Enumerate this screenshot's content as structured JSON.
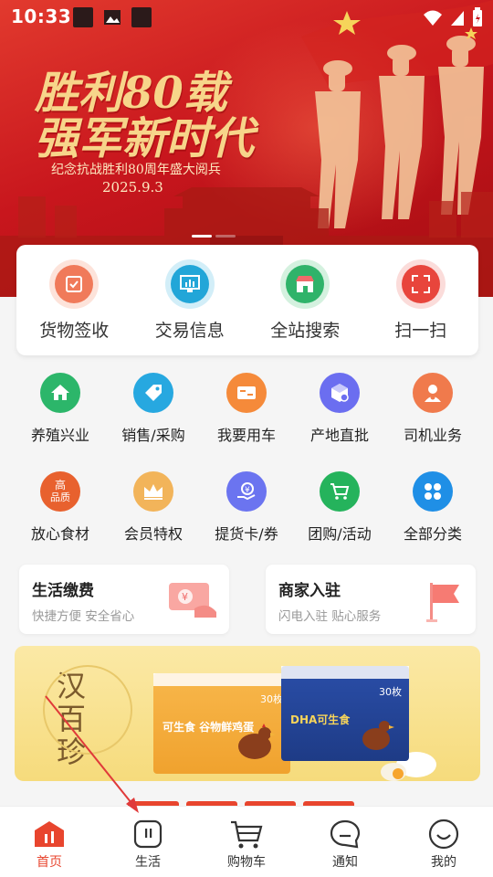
{
  "status_bar": {
    "time": "10:33"
  },
  "banner": {
    "title_line1": "胜利80载",
    "title_line2": "强军新时代",
    "subtitle": "纪念抗战胜利80周年盛大阅兵",
    "date": "2025.9.3"
  },
  "quick_actions": [
    {
      "label": "货物签收",
      "icon": "package-check-icon",
      "color": "#f07a5a"
    },
    {
      "label": "交易信息",
      "icon": "monitor-chart-icon",
      "color": "#22a6d8"
    },
    {
      "label": "全站搜索",
      "icon": "store-icon",
      "color": "#2fb36a"
    },
    {
      "label": "扫一扫",
      "icon": "scan-icon",
      "color": "#e8453c"
    }
  ],
  "grid_row1": [
    {
      "label": "养殖兴业",
      "color": "#2cb66a"
    },
    {
      "label": "销售/采购",
      "color": "#27a8e0"
    },
    {
      "label": "我要用车",
      "color": "#f58a3a"
    },
    {
      "label": "产地直批",
      "color": "#6b6ef0"
    },
    {
      "label": "司机业务",
      "color": "#f07a4c"
    }
  ],
  "grid_row2": [
    {
      "label": "放心食材",
      "badge_top": "高",
      "badge_bottom": "品质",
      "color": "#e8612e"
    },
    {
      "label": "会员特权",
      "color": "#f2b45a"
    },
    {
      "label": "提货卡/券",
      "color": "#6b74f0"
    },
    {
      "label": "团购/活动",
      "color": "#25b35c"
    },
    {
      "label": "全部分类",
      "color": "#1f8fe6"
    }
  ],
  "service_cards": [
    {
      "title": "生活缴费",
      "subtitle": "快捷方便 安全省心"
    },
    {
      "title": "商家入驻",
      "subtitle": "闪电入驻 贴心服务"
    }
  ],
  "promo": {
    "brand": "汉百珍",
    "box1_text": "可生食 谷物鲜鸡蛋",
    "box1_tag": "30枚",
    "box2_text": "DHA可生食",
    "box2_tag": "30枚"
  },
  "tabbar": [
    {
      "label": "首页",
      "icon": "home-icon",
      "active": true
    },
    {
      "label": "生活",
      "icon": "life-icon",
      "active": false
    },
    {
      "label": "购物车",
      "icon": "cart-icon",
      "active": false
    },
    {
      "label": "通知",
      "icon": "chat-bubble-icon",
      "active": false
    },
    {
      "label": "我的",
      "icon": "smile-face-icon",
      "active": false
    }
  ],
  "colors": {
    "accent": "#e8452e",
    "banner_red": "#c8161d"
  }
}
